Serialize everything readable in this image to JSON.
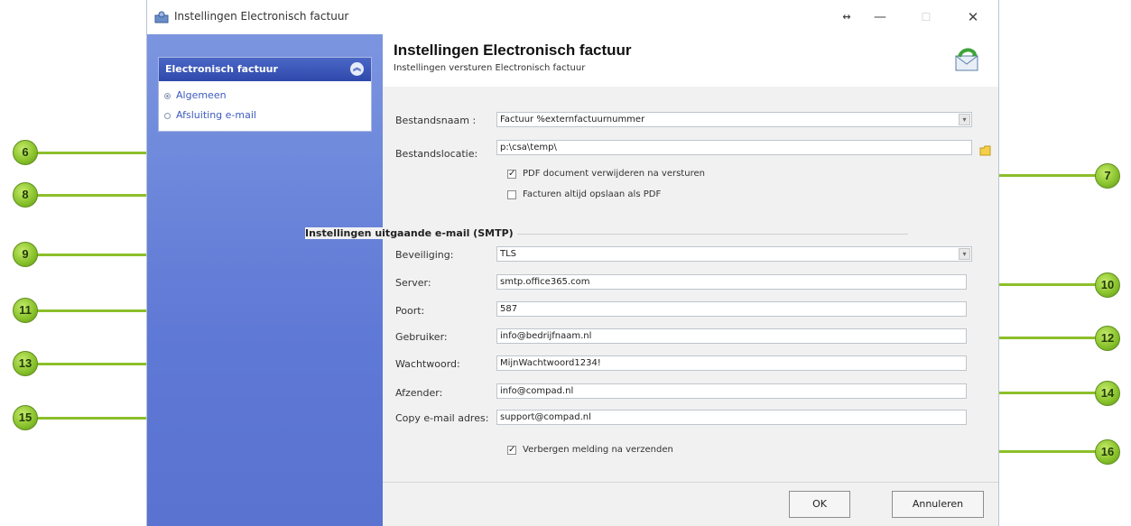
{
  "window": {
    "title": "Instellingen Electronisch factuur",
    "controls": {
      "restore": "↔",
      "minimize": "—",
      "maximize": "☐",
      "close": "✕"
    }
  },
  "sidebar": {
    "panel_title": "Electronisch factuur",
    "items": [
      {
        "label": "Algemeen",
        "selected": true
      },
      {
        "label": "Afsluiting e-mail",
        "selected": false
      }
    ]
  },
  "header": {
    "title": "Instellingen Electronisch factuur",
    "subtitle": "Instellingen versturen Electronisch factuur"
  },
  "form": {
    "bestandsnaam": {
      "label": "Bestandsnaam :",
      "value": "Factuur %externfactuurnummer"
    },
    "bestandslocatie": {
      "label": "Bestandslocatie:",
      "value": "p:\\csa\\temp\\"
    },
    "pdf_verwijderen": {
      "label": "PDF document verwijderen na versturen",
      "checked": true
    },
    "facturen_pdf": {
      "label": "Facturen altijd opslaan als PDF",
      "checked": false
    },
    "smtp_section": "Instellingen uitgaande e-mail (SMTP)",
    "beveiliging": {
      "label": "Beveiliging:",
      "value": "TLS"
    },
    "server": {
      "label": "Server:",
      "value": "smtp.office365.com"
    },
    "poort": {
      "label": "Poort:",
      "value": "587"
    },
    "gebruiker": {
      "label": "Gebruiker:",
      "value": "info@bedrijfnaam.nl"
    },
    "wachtwoord": {
      "label": "Wachtwoord:",
      "value": "MijnWachtwoord1234!"
    },
    "afzender": {
      "label": "Afzender:",
      "value": "info@compad.nl"
    },
    "copy_email": {
      "label": "Copy e-mail adres:",
      "value": "support@compad.nl"
    },
    "verbergen_melding": {
      "label": "Verbergen melding na verzenden",
      "checked": true
    }
  },
  "buttons": {
    "ok": "OK",
    "cancel": "Annuleren"
  },
  "callouts": [
    "6",
    "7",
    "8",
    "9",
    "10",
    "11",
    "12",
    "13",
    "14",
    "15",
    "16"
  ],
  "colors": {
    "callout_green": "#8cbf2a",
    "sidebar_blue": "#6a84da",
    "panel_header": "#3a56b8"
  },
  "icons": {
    "app": "settings-app-icon",
    "panel_collapse": "collapse-chevron-icon",
    "header": "envelope-icon",
    "folder": "folder-icon",
    "dropdown": "chevron-down-icon"
  }
}
